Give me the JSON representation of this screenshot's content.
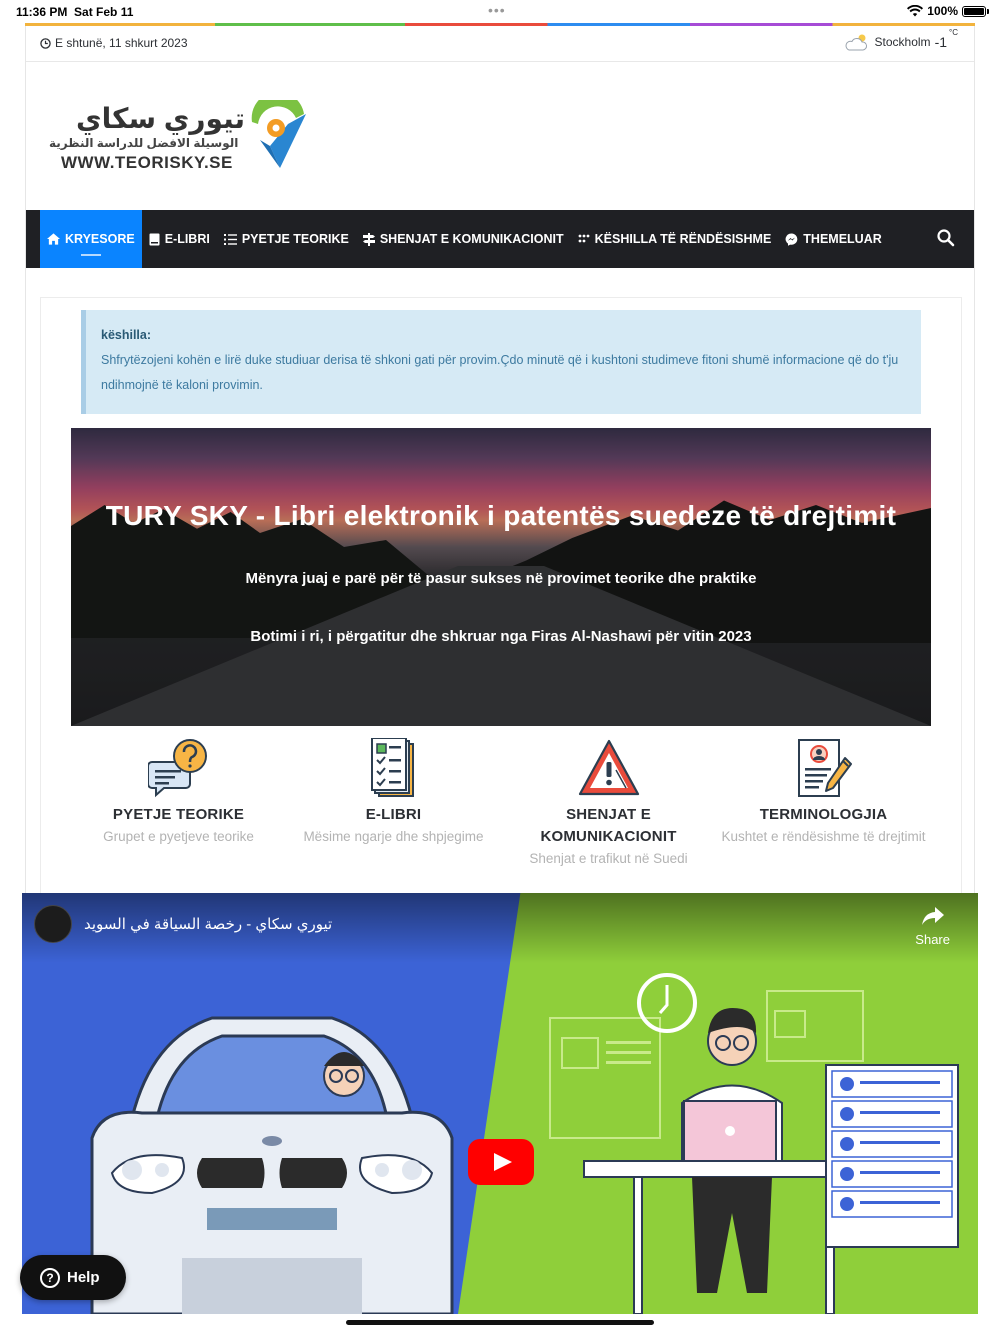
{
  "status_bar": {
    "time": "11:36 PM",
    "date": "Sat Feb 11",
    "battery": "100%"
  },
  "topbar": {
    "date": "E shtunë, 11 shkurt 2023",
    "city": "Stockholm",
    "temp": "-1",
    "unit": "°C"
  },
  "logo": {
    "arabic": "تيوري سكاي",
    "arabic_sub": "الوسيلة الافضل للدراسة النظرية",
    "url": "WWW.TEORISKY.SE"
  },
  "nav": {
    "items": [
      {
        "label": "KRYESORE",
        "icon": "home-icon"
      },
      {
        "label": "E-LIBRI",
        "icon": "book-icon"
      },
      {
        "label": "PYETJE TEORIKE",
        "icon": "list-icon"
      },
      {
        "label": "SHENJAT E KOMUNIKACIONIT",
        "icon": "signpost-icon"
      },
      {
        "label": "KËSHILLA TË RËNDËSISHME",
        "icon": "dots-icon"
      },
      {
        "label": "THEMELUAR",
        "icon": "messenger-icon"
      }
    ]
  },
  "tip": {
    "title": "këshilla:",
    "text": "Shfrytëzojeni kohën e lirë duke studiuar derisa të shkoni gati për provim.Çdo minutë që i kushtoni studimeve fitoni shumë informacione që do t'ju ndihmojnë të kaloni provimin."
  },
  "hero": {
    "title": "TURY SKY - Libri elektronik i patentës suedeze të drejtimit",
    "line1": "Mënyra juaj e parë për të pasur sukses në provimet teorike dhe praktike",
    "line2": "Botimi i ri, i përgatitur dhe shkruar nga Firas Al-Nashawi për vitin 2023"
  },
  "features": [
    {
      "title": "PYETJE TEORIKE",
      "subtitle": "Grupet e pyetjeve teorike",
      "icon": "question-chat-icon"
    },
    {
      "title": "E-LIBRI",
      "subtitle": "Mësime ngarje dhe shpjegime",
      "icon": "checklist-doc-icon"
    },
    {
      "title": "SHENJAT E KOMUNIKACIONIT",
      "subtitle": "Shenjat e trafikut në Suedi",
      "icon": "warning-sign-icon"
    },
    {
      "title": "TERMINOLOGJIA",
      "subtitle": "Kushtet e rëndësishme të drejtimit",
      "icon": "document-pencil-icon"
    }
  ],
  "video": {
    "title": "تيوري سكاي - رخصة السياقة في السويد",
    "share": "Share"
  },
  "help": {
    "label": "Help"
  }
}
